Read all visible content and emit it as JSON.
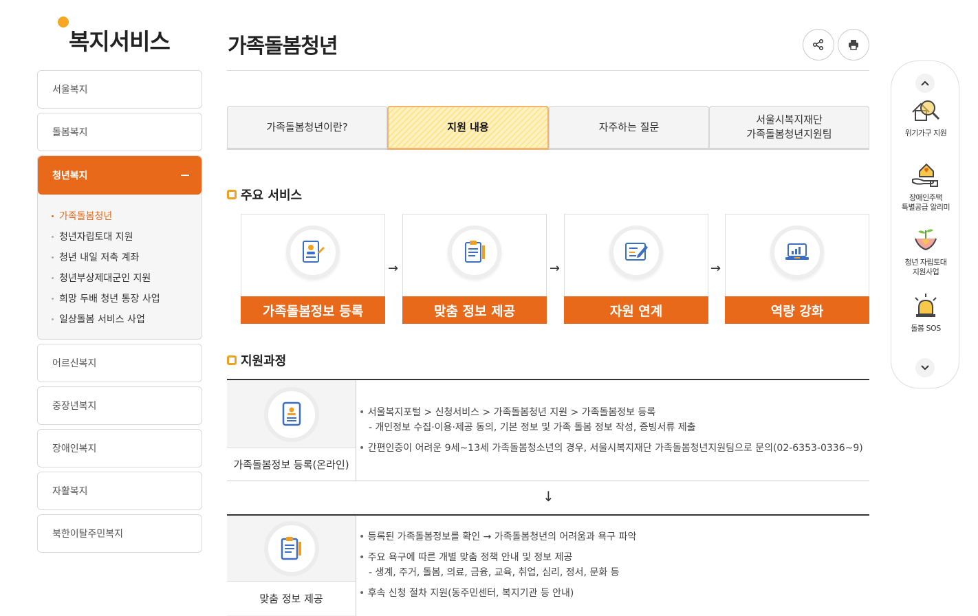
{
  "sidebar": {
    "title": "복지서비스",
    "items_before": [
      "서울복지",
      "돌봄복지"
    ],
    "open_item": {
      "label": "청년복지",
      "sub_items": [
        "가족돌봄청년",
        "청년자립토대 지원",
        "청년 내일 저축 계좌",
        "청년부상제대군인 지원",
        "희망 두배 청년 통장 사업",
        "일상돌봄 서비스 사업"
      ]
    },
    "items_after": [
      "어르신복지",
      "중장년복지",
      "장애인복지",
      "자활복지",
      "북한이탈주민복지"
    ]
  },
  "header": {
    "title": "가족돌봄청년",
    "share_icon": "share-icon",
    "print_icon": "print-icon"
  },
  "tabs": [
    {
      "label": "가족돌봄청년이란?",
      "active": false
    },
    {
      "label": "지원 내용",
      "active": true
    },
    {
      "label": "자주하는 질문",
      "active": false
    },
    {
      "label": "서울시복지재단\n가족돌봄청년지원팀",
      "active": false
    }
  ],
  "main_services": {
    "heading": "주요 서비스",
    "cards": [
      {
        "label": "가족돌봄정보 등록",
        "icon": "registration-doc-icon"
      },
      {
        "label": "맞춤 정보 제공",
        "icon": "clipboard-icon"
      },
      {
        "label": "자원 연계",
        "icon": "edit-doc-icon"
      },
      {
        "label": "역량 강화",
        "icon": "laptop-chart-icon"
      }
    ],
    "arrow": "→"
  },
  "process": {
    "heading": "지원과정",
    "down_arrow": "↓",
    "steps": [
      {
        "label": "가족돌봄정보 등록(온라인)",
        "icon": "person-doc-icon",
        "lines": [
          {
            "type": "b",
            "text": "서울복지포털 > 신청서비스 > 가족돌봄청년 지원 > 가족돌봄정보 등록"
          },
          {
            "type": "sub",
            "text": "- 개인정보 수집·이용·제공 동의, 기본 정보 및 가족 돌봄 정보 작성, 증빙서류 제출"
          },
          {
            "type": "gap",
            "text": ""
          },
          {
            "type": "b",
            "text": "간편인증이 어려운 9세~13세 가족돌봄청소년의 경우, 서울시복지재단 가족돌봄청년지원팀으로 문의(02-6353-0336~9)"
          }
        ]
      },
      {
        "label": "맞춤 정보 제공",
        "icon": "clipboard-pen-icon",
        "lines": [
          {
            "type": "b",
            "text": "등록된 가족돌봄정보를 확인 → 가족돌봄청년의 어려움과 욕구 파악"
          },
          {
            "type": "gap",
            "text": ""
          },
          {
            "type": "b",
            "text": "주요 욕구에 따른 개별 맞춤 정책 안내 및 정보 제공"
          },
          {
            "type": "sub",
            "text": "- 생계, 주거, 돌봄, 의료, 금융, 교육, 취업, 심리, 정서, 문화 등"
          },
          {
            "type": "gap",
            "text": ""
          },
          {
            "type": "b",
            "text": "후속 신청 절차 지원(동주민센터, 복지기관 등 안내)"
          }
        ]
      }
    ]
  },
  "quick_panel": {
    "up": "⌃",
    "down": "⌄",
    "items": [
      {
        "label": "위기가구 지원",
        "icon": "magnifier-house-icon"
      },
      {
        "label": "장애인주택\n특별공급 알리미",
        "icon": "hand-house-icon"
      },
      {
        "label": "청년 자립토대\n지원사업",
        "icon": "hands-sprout-icon"
      },
      {
        "label": "돌봄 SOS",
        "icon": "alarm-bell-icon"
      }
    ]
  },
  "colors": {
    "accent": "#e8691a",
    "yellow": "#f7a823"
  }
}
